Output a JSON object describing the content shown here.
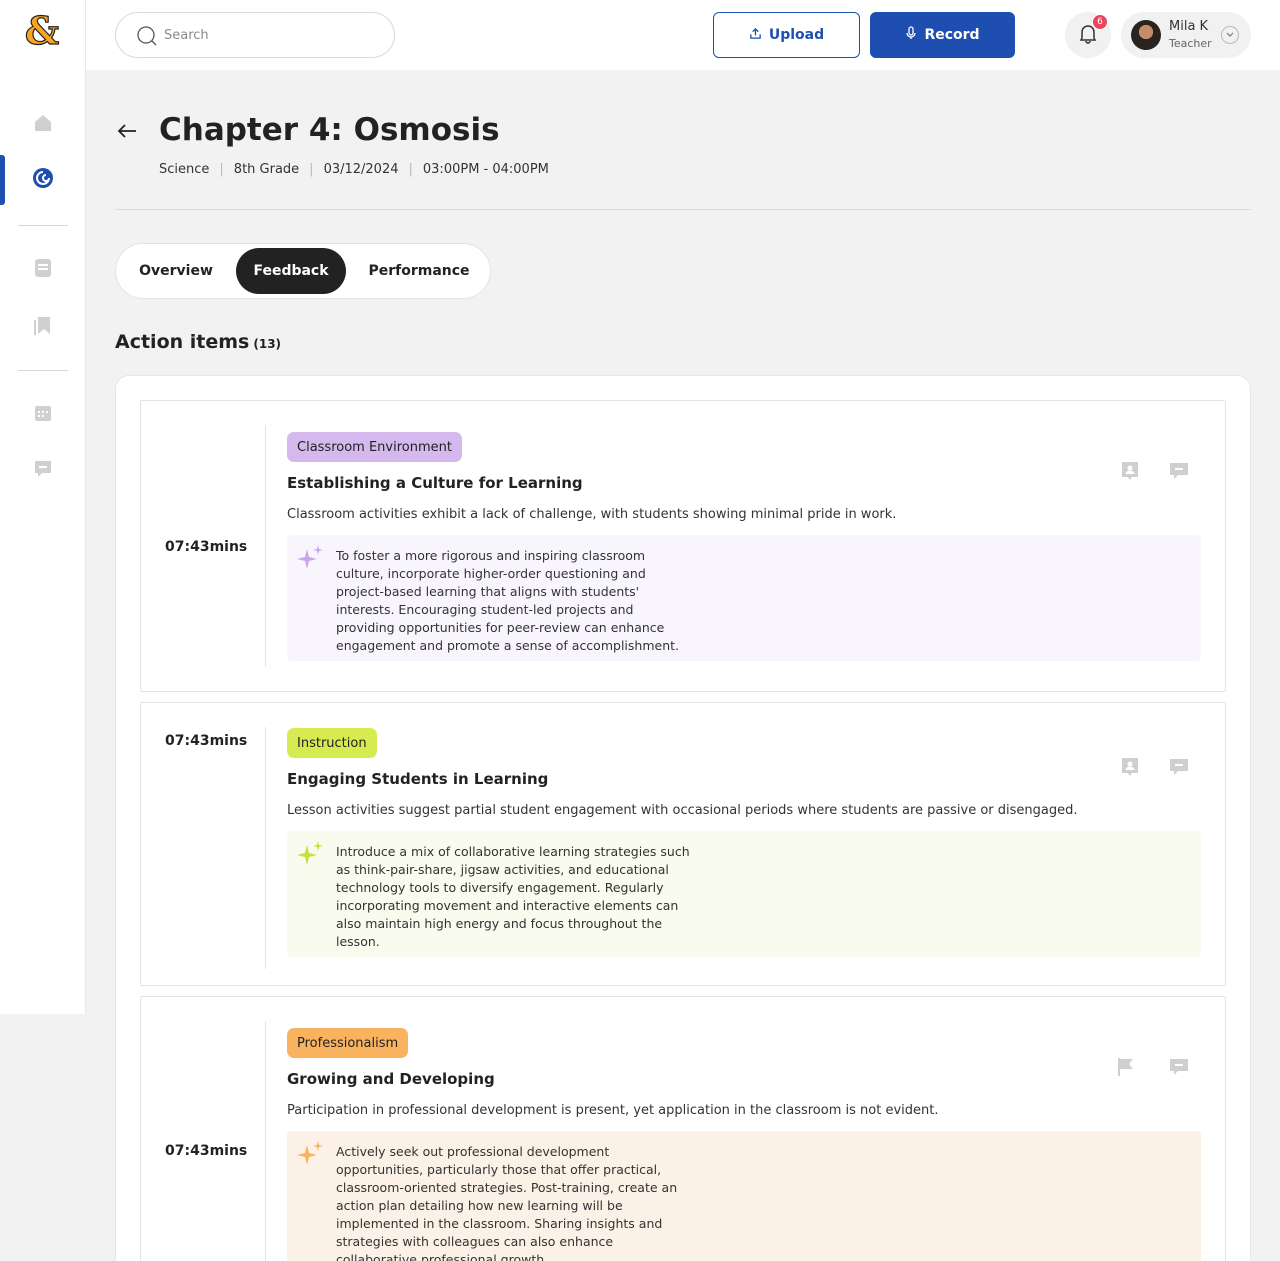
{
  "header": {
    "search_placeholder": "Search",
    "upload_label": "Upload",
    "record_label": "Record",
    "notification_count": "6",
    "user": {
      "name": "Mila K",
      "role": "Teacher"
    }
  },
  "page": {
    "title": "Chapter 4: Osmosis",
    "meta": {
      "subject": "Science",
      "grade": "8th Grade",
      "date": "03/12/2024",
      "time": "03:00PM - 04:00PM"
    }
  },
  "tabs": [
    {
      "label": "Overview"
    },
    {
      "label": "Feedback"
    },
    {
      "label": "Performance"
    }
  ],
  "action_items": {
    "heading": "Action items",
    "count": "(13)",
    "items": [
      {
        "time": "07:43mins",
        "tag": "Classroom Environment",
        "title": "Establishing a Culture for Learning",
        "description": "Classroom activities exhibit a lack of challenge, with students showing minimal pride in work.",
        "suggestion": "To foster a more rigorous and inspiring classroom culture, incorporate higher-order questioning and project-based learning that aligns with students' interests. Encouraging student-led projects and providing opportunities for peer-review can enhance engagement and promote a sense of accomplishment."
      },
      {
        "time": "07:43mins",
        "tag": "Instruction",
        "title": "Engaging Students in Learning",
        "description": "Lesson activities suggest partial student engagement with occasional periods where students are passive or disengaged.",
        "suggestion": "Introduce a mix of collaborative learning strategies such as think-pair-share, jigsaw activities, and educational technology tools to diversify engagement. Regularly incorporating movement and interactive elements can also maintain high energy and focus throughout the lesson."
      },
      {
        "time": "07:43mins",
        "tag": "Professionalism",
        "title": "Growing and Developing",
        "description": "Participation in professional development is present, yet application in the classroom is not evident.",
        "suggestion": "Actively seek out professional development opportunities, particularly those that offer practical, classroom-oriented strategies. Post-training, create an action plan detailing how new learning will be implemented in the classroom. Sharing insights and strategies with colleagues can also enhance collaborative professional growth."
      }
    ]
  },
  "colors": {
    "primary": "#1e4fb0",
    "tag_classroom_environment": "#d4b8ee",
    "tag_instruction": "#d6eb4f",
    "tag_professionalism": "#f9b25e",
    "suggest_classroom_environment": "#f8f6fc",
    "suggest_instruction": "#f8fbee",
    "suggest_professionalism": "#fcf1e6",
    "badge": "#e8455e"
  }
}
